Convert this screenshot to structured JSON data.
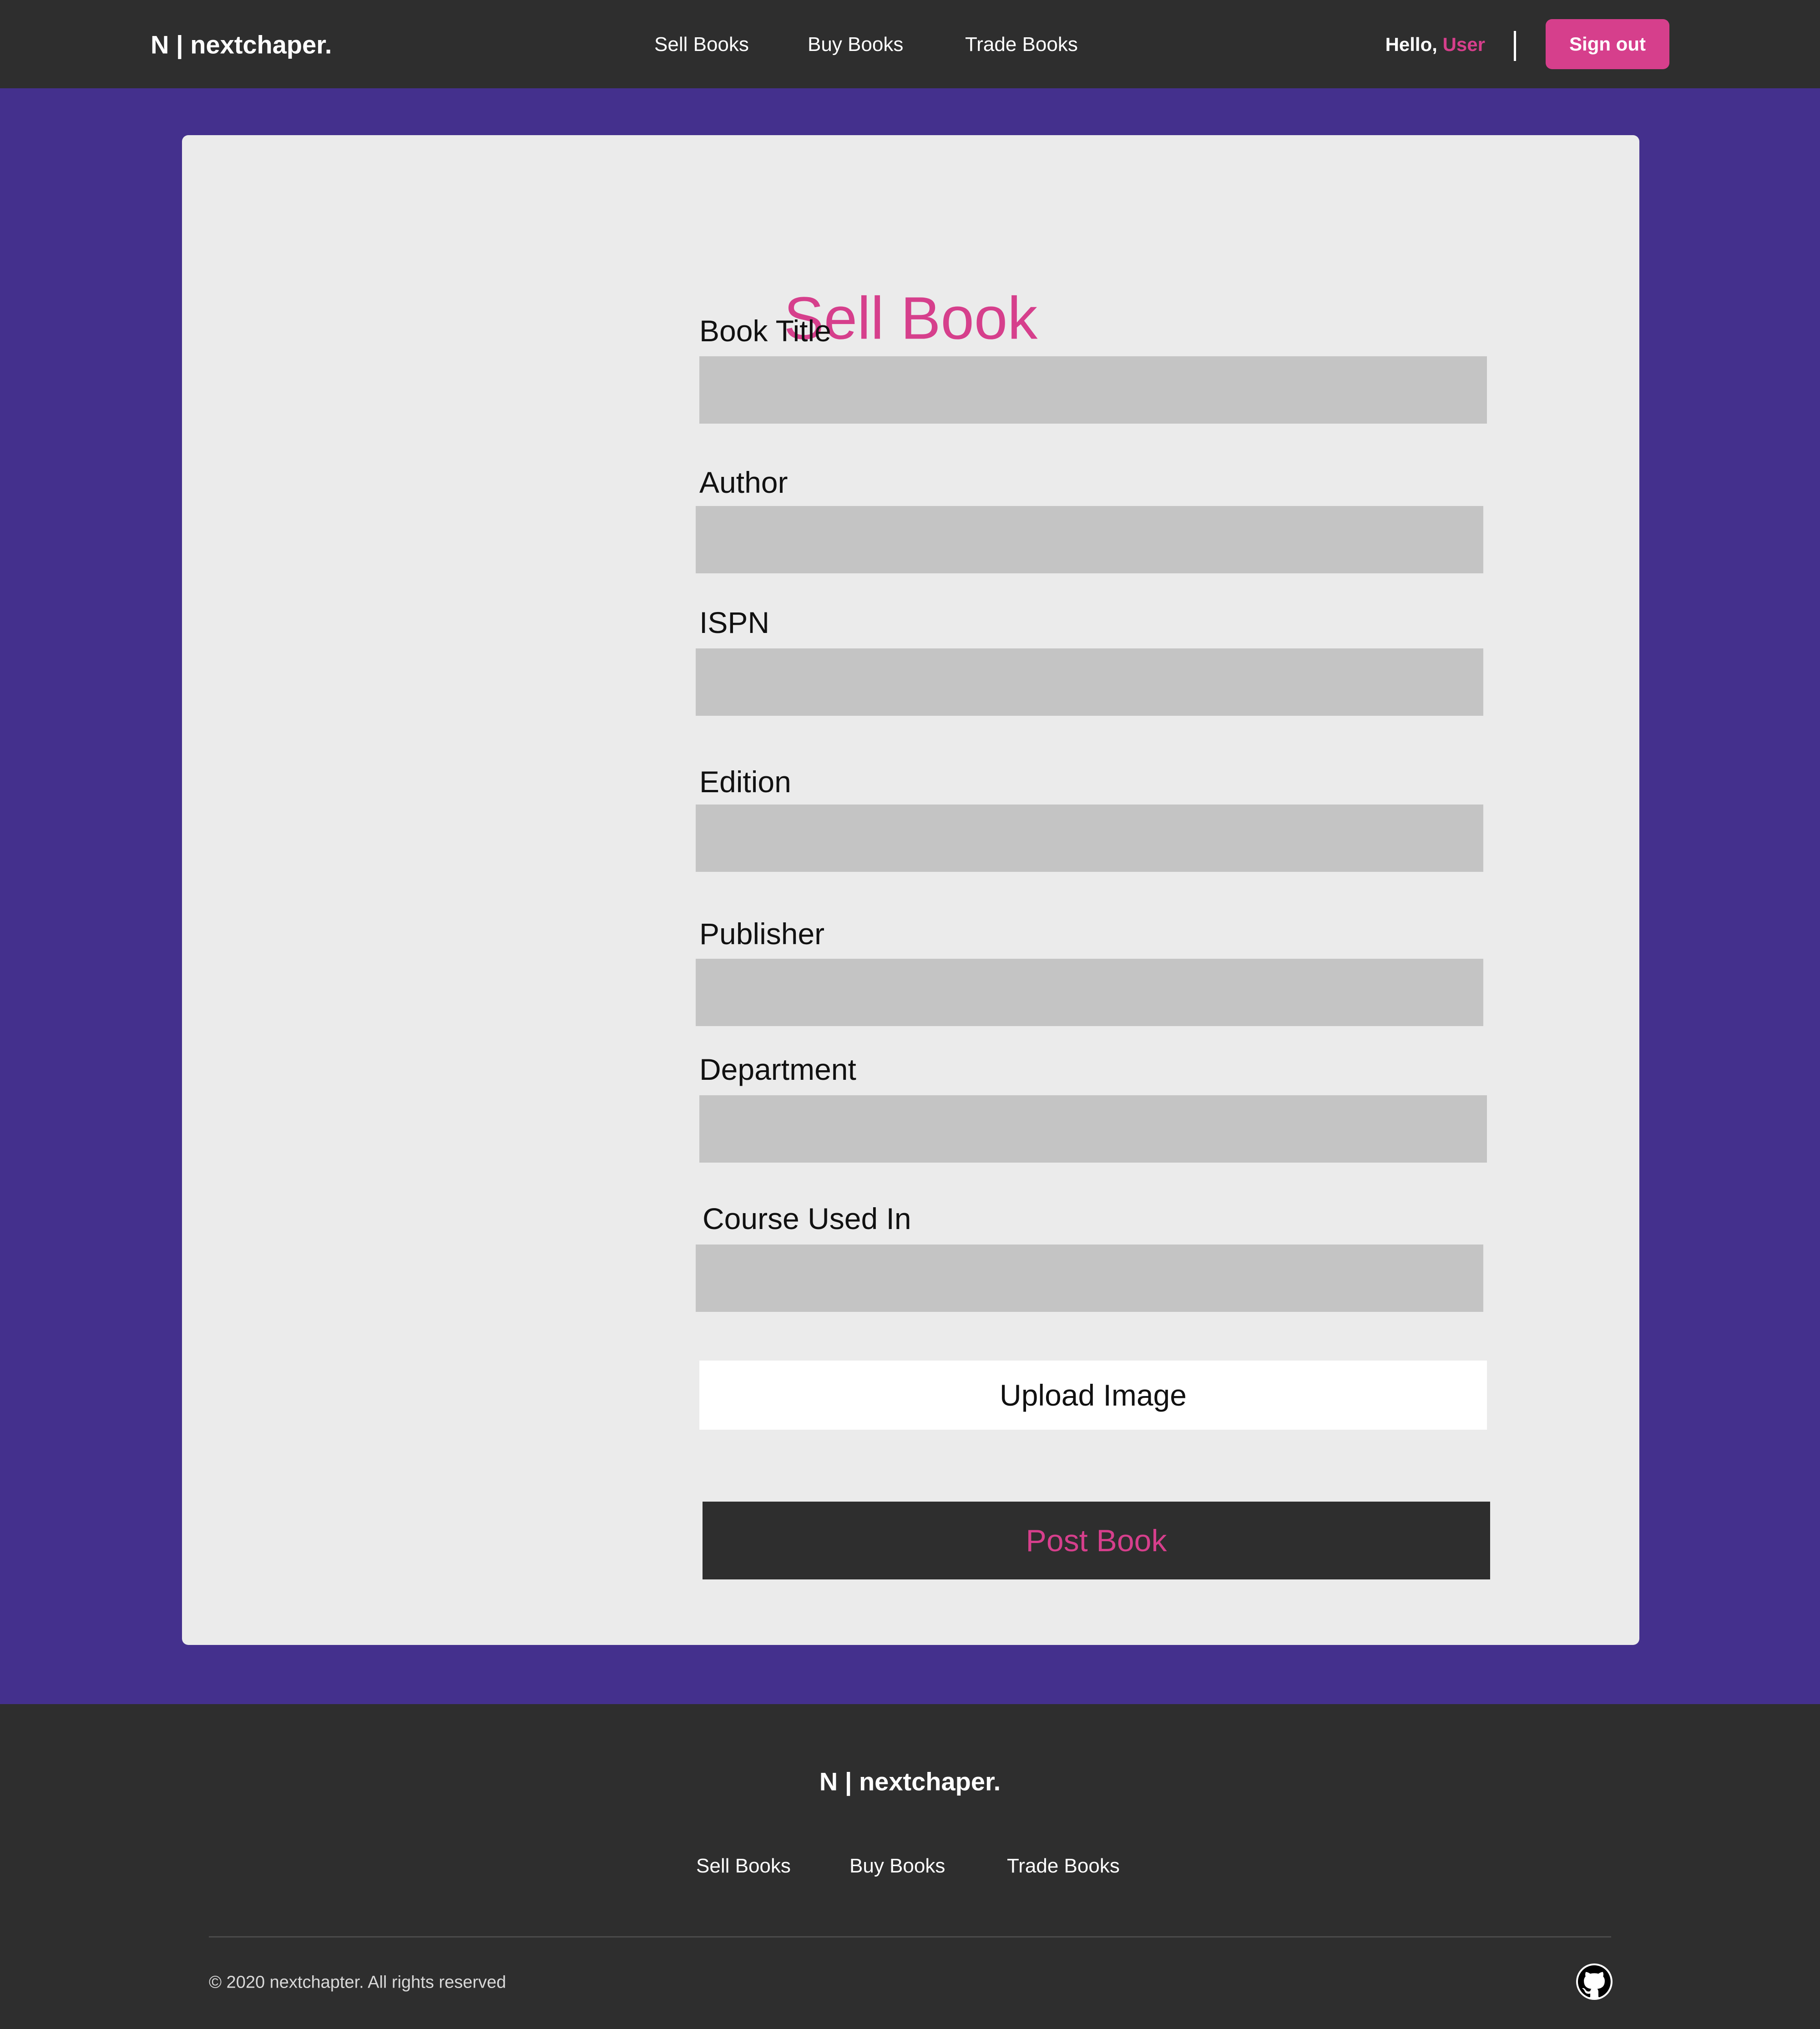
{
  "header": {
    "brand": "N | nextchaper.",
    "nav": [
      "Sell Books",
      "Buy Books",
      "Trade Books"
    ],
    "greeting_prefix": "Hello, ",
    "username": "User",
    "signout_label": "Sign out"
  },
  "form": {
    "title": "Sell Book",
    "fields": [
      {
        "label": "Book Title",
        "value": ""
      },
      {
        "label": "Author",
        "value": ""
      },
      {
        "label": "ISPN",
        "value": ""
      },
      {
        "label": "Edition",
        "value": ""
      },
      {
        "label": "Publisher",
        "value": ""
      },
      {
        "label": "Department",
        "value": ""
      },
      {
        "label": "Course Used In",
        "value": ""
      }
    ],
    "upload_label": "Upload Image",
    "submit_label": "Post Book"
  },
  "footer": {
    "brand": "N | nextchaper.",
    "nav": [
      "Sell Books",
      "Buy Books",
      "Trade Books"
    ],
    "copyright": "© 2020 nextchapter. All rights reserved",
    "social_icon": "github-icon"
  },
  "colors": {
    "background": "#44308d",
    "bar": "#2e2e2e",
    "accent": "#d63f8c",
    "card": "#ebebeb",
    "input": "#c4c4c4"
  }
}
